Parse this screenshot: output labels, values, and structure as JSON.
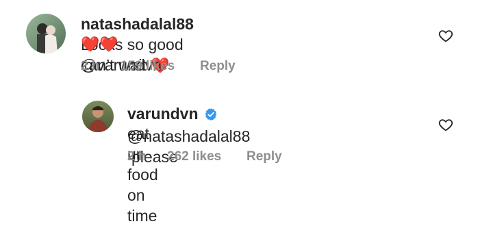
{
  "comments": [
    {
      "username": "natashadalal88",
      "text": "Looks so good can’t wait",
      "hearts_line1": "❤️",
      "hearts_line2": "❤️❤️",
      "mention": "@varundvn",
      "time": "2 h",
      "likes": "159 likes",
      "reply": "Reply"
    },
    {
      "username": "varundvn",
      "verified": true,
      "mention": "@natashadalal88",
      "text_line1": "please",
      "text_line2": "eat ur food on time",
      "time": "2 h",
      "likes": "262 likes",
      "reply": "Reply"
    }
  ],
  "colors": {
    "text": "#262626",
    "meta": "#8e8e8e",
    "verified": "#3897f0",
    "heart": "#e0245e"
  }
}
